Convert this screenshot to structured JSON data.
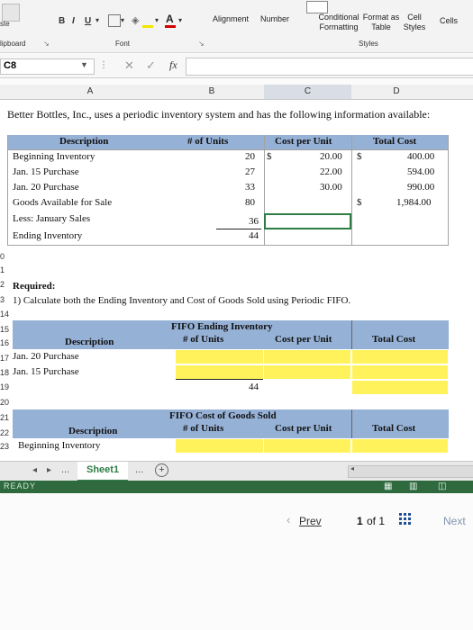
{
  "ribbon": {
    "paste_label": "ste",
    "bold": "B",
    "italic": "I",
    "underline": "U",
    "alignment": "Alignment",
    "number": "Number",
    "conditional_formatting": "Conditional Formatting",
    "format_as_table": "Format as Table",
    "cell_styles": "Cell Styles",
    "cells": "Cells",
    "group_clipboard": "lipboard",
    "group_font": "Font",
    "group_styles": "Styles"
  },
  "formula_bar": {
    "name_box": "C8",
    "fx": "fx",
    "value": ""
  },
  "columns": [
    "A",
    "B",
    "C",
    "D"
  ],
  "sheet": {
    "intro": "Better Bottles, Inc., uses a periodic inventory system and has the following information available:",
    "table1_headers": [
      "Description",
      "# of Units",
      "Cost per Unit",
      "Total Cost"
    ],
    "table1_rows": [
      {
        "desc": "Beginning Inventory",
        "units": "20",
        "cur": "$",
        "cost": "20.00",
        "tcur": "$",
        "total": "400.00"
      },
      {
        "desc": "Jan. 15 Purchase",
        "units": "27",
        "cur": "",
        "cost": "22.00",
        "tcur": "",
        "total": "594.00"
      },
      {
        "desc": "Jan. 20 Purchase",
        "units": "33",
        "cur": "",
        "cost": "30.00",
        "tcur": "",
        "total": "990.00"
      },
      {
        "desc": "Goods Available for Sale",
        "units": "80",
        "cur": "",
        "cost": "",
        "tcur": "$",
        "total": "1,984.00"
      },
      {
        "desc": "Less: January Sales",
        "units": "36",
        "cur": "",
        "cost": "",
        "tcur": "",
        "total": ""
      },
      {
        "desc": "Ending Inventory",
        "units": "44",
        "cur": "",
        "cost": "",
        "tcur": "",
        "total": ""
      }
    ],
    "required": "Required:",
    "question": "1) Calculate both the Ending Inventory and Cost of Goods Sold using Periodic FIFO.",
    "fifo_end_title": "FIFO Ending Inventory",
    "fifo_end_headers": [
      "Description",
      "# of Units",
      "Cost per Unit",
      "Total Cost"
    ],
    "fifo_end_rows": [
      "Jan. 20 Purchase",
      "Jan. 15 Purchase"
    ],
    "fifo_end_total_units": "44",
    "fifo_cogs_title": "FIFO Cost of Goods Sold",
    "fifo_cogs_headers": [
      "Description",
      "# of Units",
      "Cost per Unit",
      "Total Cost"
    ],
    "fifo_cogs_rows": [
      "Beginning Inventory"
    ],
    "row_numbers": [
      "0",
      "1",
      "2",
      "3",
      "14",
      "15",
      "16",
      "17",
      "18",
      "19",
      "20",
      "21",
      "22",
      "23"
    ]
  },
  "tabs": {
    "sheet1": "Sheet1",
    "more": "..."
  },
  "status": "READY",
  "pager": {
    "prev": "Prev",
    "page": "1",
    "of": "of 1",
    "next": "Next"
  }
}
